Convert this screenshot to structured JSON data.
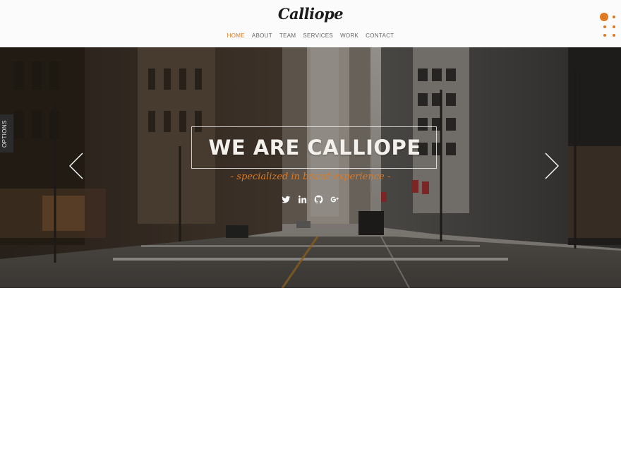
{
  "header": {
    "logo": "Calliope",
    "nav": [
      {
        "label": "HOME",
        "active": true
      },
      {
        "label": "ABOUT",
        "active": false
      },
      {
        "label": "TEAM",
        "active": false
      },
      {
        "label": "SERVICES",
        "active": false
      },
      {
        "label": "WORK",
        "active": false
      },
      {
        "label": "CONTACT",
        "active": false
      }
    ],
    "menu_icon": "dots-menu-icon"
  },
  "options_tab": {
    "label": "OPTIONS"
  },
  "hero": {
    "title": "WE ARE CALLIOPE",
    "subtitle": "- specialized in brand experience -",
    "background": "city-street-photo",
    "social_icons": [
      "twitter-icon",
      "linkedin-icon",
      "github-icon",
      "google-plus-icon"
    ],
    "prev_icon": "chevron-left-icon",
    "next_icon": "chevron-right-icon"
  },
  "colors": {
    "accent": "#e07a22",
    "header_bg": "#fbfbfb",
    "nav_text": "#666666",
    "hero_title": "#f4f1ec"
  }
}
